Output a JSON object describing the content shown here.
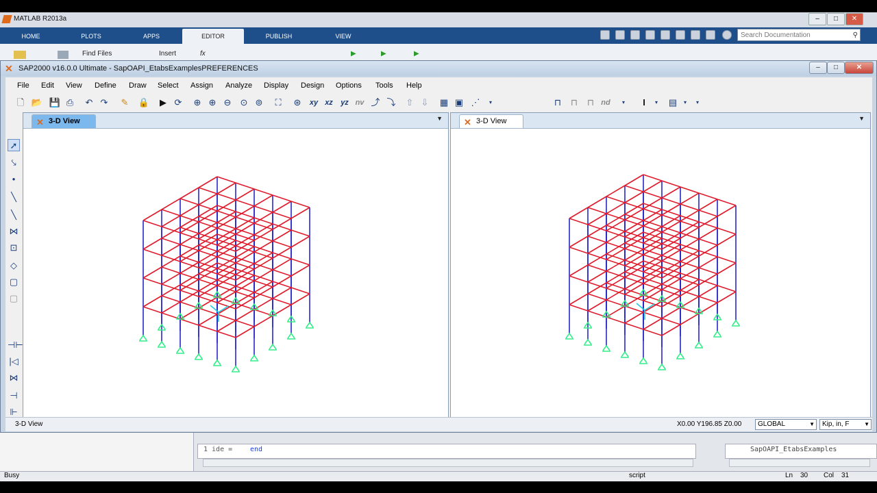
{
  "matlab": {
    "title": "MATLAB R2013a",
    "tabs": [
      "HOME",
      "PLOTS",
      "APPS",
      "EDITOR",
      "PUBLISH",
      "VIEW"
    ],
    "active_tab": "EDITOR",
    "search_placeholder": "Search Documentation",
    "toolstrip": {
      "find_files": "Find Files",
      "insert": "Insert",
      "fx": "fx"
    },
    "editor_line": {
      "a": "1 ide =",
      "b": "end"
    },
    "editor_right": "SapOAPI_EtabsExamples",
    "status": {
      "state": "Busy",
      "mode": "script",
      "ln_label": "Ln",
      "ln": "30",
      "col_label": "Col",
      "col": "31"
    }
  },
  "sap": {
    "title": "SAP2000 v16.0.0 Ultimate  - SapOAPI_EtabsExamplesPREFERENCES",
    "menu": [
      "File",
      "Edit",
      "View",
      "Define",
      "Draw",
      "Select",
      "Assign",
      "Analyze",
      "Display",
      "Design",
      "Options",
      "Tools",
      "Help"
    ],
    "toolbar_text": {
      "xy": "xy",
      "xz": "xz",
      "yz": "yz",
      "nv": "nv",
      "nd": "nd"
    },
    "panes": [
      {
        "tab": "3-D View",
        "active": true
      },
      {
        "tab": "3-D View",
        "active": false
      }
    ],
    "status": {
      "view_label": "3-D View",
      "coords": "X0.00  Y196.85  Z0.00",
      "coord_system": "GLOBAL",
      "units": "Kip, in, F"
    }
  },
  "colors": {
    "beam": "#e01c2c",
    "column": "#2626c8",
    "support": "#33ee88",
    "tab_active": "#7bb8ee"
  },
  "icons": [
    "new-file-icon",
    "open-icon",
    "save-icon",
    "print-icon",
    "undo-icon",
    "redo-icon",
    "pencil-icon",
    "lock-icon",
    "run-icon",
    "refresh-icon",
    "zoom-in-icon",
    "zoom-out-icon",
    "pointer-icon"
  ]
}
